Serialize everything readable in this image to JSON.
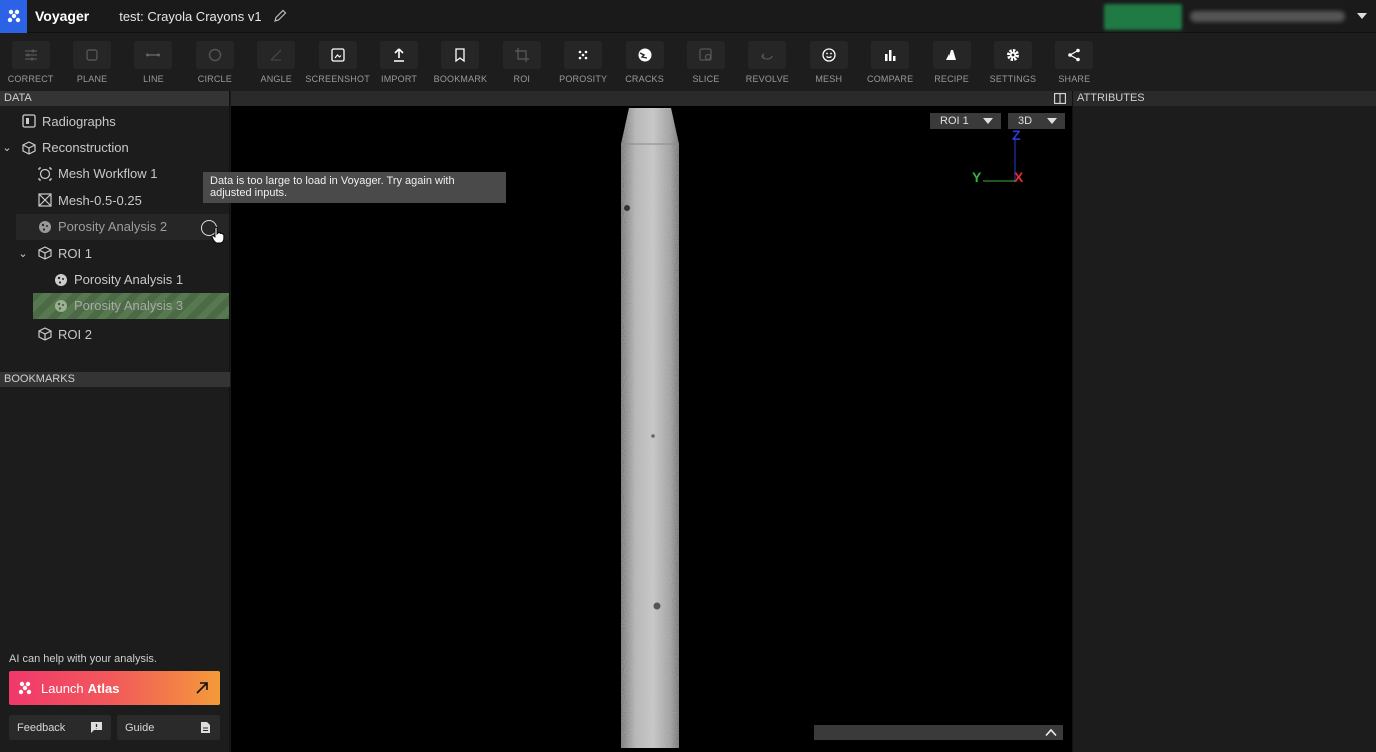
{
  "app": {
    "name": "Voyager",
    "project_title": "test: Crayola Crayons v1"
  },
  "toolbar": {
    "tools": [
      {
        "id": "correct",
        "label": "CORRECT",
        "icon": "sliders-icon"
      },
      {
        "id": "plane",
        "label": "PLANE",
        "icon": "square-icon"
      },
      {
        "id": "line",
        "label": "LINE",
        "icon": "line-icon"
      },
      {
        "id": "circle",
        "label": "CIRCLE",
        "icon": "circle-icon"
      },
      {
        "id": "angle",
        "label": "ANGLE",
        "icon": "angle-icon"
      },
      {
        "id": "screenshot",
        "label": "SCREENSHOT",
        "icon": "screenshot-icon"
      },
      {
        "id": "import",
        "label": "IMPORT",
        "icon": "upload-icon"
      },
      {
        "id": "bookmark",
        "label": "BOOKMARK",
        "icon": "bookmark-icon"
      },
      {
        "id": "roi",
        "label": "ROI",
        "icon": "crop-icon"
      },
      {
        "id": "porosity",
        "label": "POROSITY",
        "icon": "porosity-icon"
      },
      {
        "id": "cracks",
        "label": "CRACKS",
        "icon": "cracks-icon"
      },
      {
        "id": "slice",
        "label": "SLICE",
        "icon": "slice-icon"
      },
      {
        "id": "revolve",
        "label": "REVOLVE",
        "icon": "revolve-icon"
      },
      {
        "id": "mesh",
        "label": "MESH",
        "icon": "mesh-icon"
      },
      {
        "id": "compare",
        "label": "COMPARE",
        "icon": "bar-chart-icon"
      },
      {
        "id": "recipe",
        "label": "RECIPE",
        "icon": "recipe-icon"
      },
      {
        "id": "settings",
        "label": "SETTINGS",
        "icon": "gear-icon"
      },
      {
        "id": "share",
        "label": "SHARE",
        "icon": "share-icon"
      }
    ]
  },
  "data_panel": {
    "title": "DATA",
    "tree": [
      {
        "label": "Radiographs",
        "icon": "radiograph-icon",
        "chevron": ""
      },
      {
        "label": "Reconstruction",
        "icon": "cube-icon",
        "chevron": "expanded"
      },
      {
        "label": "Mesh Workflow 1",
        "icon": "mesh-workflow-icon",
        "chevron": ""
      },
      {
        "label": "Mesh-0.5-0.25",
        "icon": "mesh-box-icon",
        "chevron": ""
      },
      {
        "label": "Porosity Analysis 2",
        "icon": "porosity-globe-icon",
        "chevron": ""
      },
      {
        "label": "ROI 1",
        "icon": "cube-icon",
        "chevron": "expanded"
      },
      {
        "label": "Porosity Analysis 1",
        "icon": "porosity-globe-icon",
        "chevron": ""
      },
      {
        "label": "Porosity Analysis 3",
        "icon": "porosity-globe-icon",
        "chevron": ""
      },
      {
        "label": "ROI 2",
        "icon": "cube-icon",
        "chevron": ""
      }
    ]
  },
  "bookmarks_panel": {
    "title": "BOOKMARKS"
  },
  "assistant": {
    "prompt": "AI can help with your analysis.",
    "launch_prefix": "Launch",
    "launch_name": "Atlas"
  },
  "footer_buttons": {
    "feedback": "Feedback",
    "guide": "Guide"
  },
  "viewport": {
    "tooltip": "Data is too large to load in Voyager. Try again with adjusted inputs.",
    "roi_select": "ROI 1",
    "view_select": "3D",
    "axes": {
      "z": "Z",
      "y": "Y",
      "x": "X"
    },
    "colors": {
      "z": "#2b3cd6",
      "y": "#3fae3f",
      "x": "#e0302b"
    }
  },
  "attributes_panel": {
    "title": "ATTRIBUTES"
  },
  "colors": {
    "brand": "#2c63e6",
    "selection": "#57794f",
    "atlas_start": "#f0386b",
    "atlas_end": "#f39a3a"
  }
}
